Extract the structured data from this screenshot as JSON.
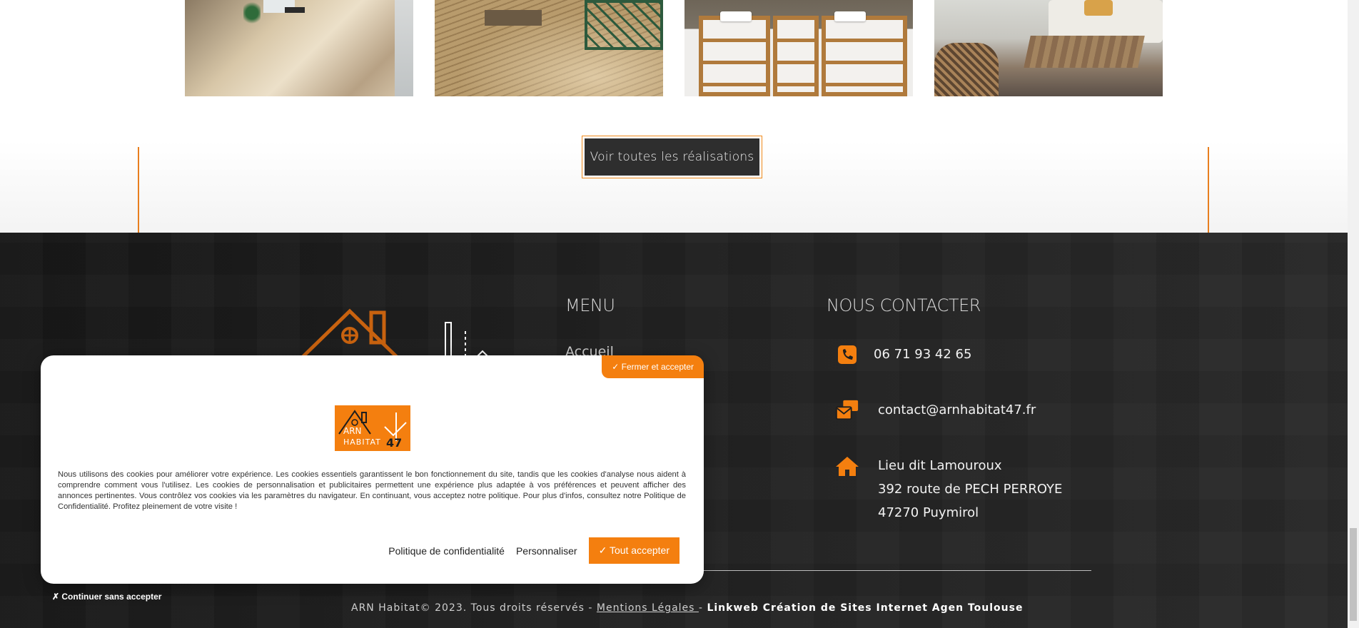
{
  "gallery": {
    "images": [
      {
        "alt": "travertine-floor"
      },
      {
        "alt": "wood-deck-terrace"
      },
      {
        "alt": "wood-bathroom-vanity"
      },
      {
        "alt": "patio-lounge-furniture"
      }
    ],
    "cta_label": "Voir toutes les réalisations"
  },
  "footer": {
    "menu_title": "MENU",
    "menu_items": [
      "Accueil"
    ],
    "contact_title": "NOUS CONTACTER",
    "phone": "06 71 93 42 65",
    "email": "contact@arnhabitat47.fr",
    "address_line1": "Lieu dit Lamouroux",
    "address_line2": "392 route de PECH PERROYE",
    "address_line3": "47270 Puymirol",
    "copyright_prefix": "ARN Habitat© 2023. Tous droits réservés - ",
    "legal_link": "Mentions Légales ",
    "copyright_sep": " - ",
    "agency": "Linkweb Création de Sites Internet Agen Toulouse"
  },
  "cookie": {
    "close_accept_label": "✓ Fermer et accepter",
    "logo_text_1": "ARN",
    "logo_text_2": "HABITAT",
    "logo_text_3": "47",
    "body": "Nous utilisons des cookies pour améliorer votre expérience. Les cookies essentiels garantissent le bon fonctionnement du site, tandis que les cookies d'analyse nous aident à comprendre comment vous l'utilisez. Les cookies de personnalisation et publicitaires permettent une expérience plus adaptée à vos préférences et peuvent afficher des annonces pertinentes. Vous contrôlez vos cookies via les paramètres du navigateur. En continuant, vous acceptez notre politique. Pour plus d'infos, consultez notre Politique de Confidentialité. Profitez pleinement de votre visite !",
    "privacy_label": "Politique de confidentialité",
    "customize_label": "Personnaliser",
    "accept_all_label": "✓ Tout accepter",
    "continue_label": "✗ Continuer sans accepter"
  },
  "colors": {
    "accent": "#f47f0f",
    "footer_bg": "#1e1e1e",
    "cta_bg": "#2e2e2e"
  },
  "icons": {
    "phone": "phone-icon",
    "mail": "envelope-icon",
    "home": "home-icon"
  }
}
